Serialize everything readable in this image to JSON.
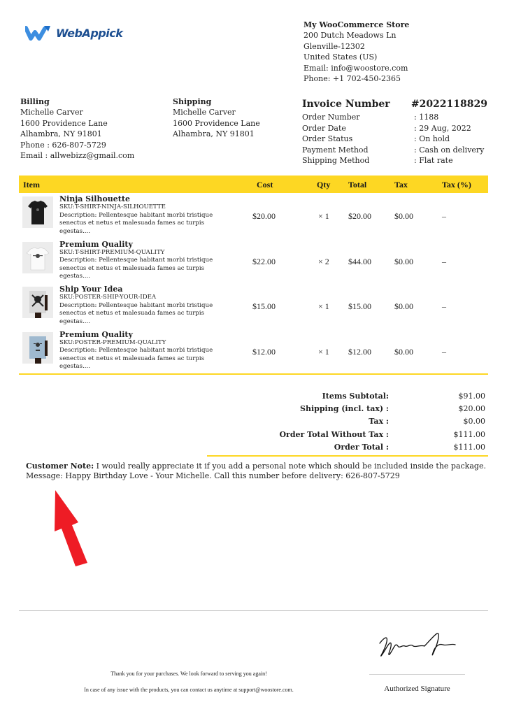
{
  "brand": {
    "logo_text": "WebAppick",
    "logo_color": "#1d4f91",
    "logo_mark_color": "#3d8ee0"
  },
  "store": {
    "name": "My WooCommerce Store",
    "lines": [
      "200 Dutch Meadows Ln",
      "Glenville-12302",
      "United States (US)",
      "Email: info@woostore.com",
      "Phone: +1 702-450-2365"
    ]
  },
  "billing": {
    "heading": "Billing",
    "lines": [
      "Michelle Carver",
      "1600 Providence Lane",
      "Alhambra, NY 91801",
      "Phone : 626-807-5729",
      "Email : allwebizz@gmail.com"
    ]
  },
  "shipping": {
    "heading": "Shipping",
    "lines": [
      "Michelle Carver",
      "1600 Providence Lane",
      "Alhambra, NY 91801"
    ]
  },
  "invoice": {
    "label": "Invoice Number",
    "number": "#2022118829",
    "fields": [
      {
        "label": "Order Number",
        "value": ": 1188"
      },
      {
        "label": "Order Date",
        "value": ": 29 Aug, 2022"
      },
      {
        "label": "Order Status",
        "value": ": On hold"
      },
      {
        "label": "Payment Method",
        "value": ": Cash on delivery"
      },
      {
        "label": "Shipping Method",
        "value": ": Flat rate"
      }
    ]
  },
  "table": {
    "accent_color": "#fdd723",
    "headers": {
      "item": "Item",
      "cost": "Cost",
      "qty": "Qty",
      "total": "Total",
      "tax": "Tax",
      "tax_pct": "Tax (%)"
    },
    "rows": [
      {
        "name": "Ninja Silhouette",
        "sku": "SKU:T-SHIRT-NINJA-SILHOUETTE",
        "description": "Description: Pellentesque habitant morbi tristique senectus et netus et malesuada fames ac turpis egestas....",
        "cost": "$20.00",
        "qty": "× 1",
        "total": "$20.00",
        "tax": "$0.00",
        "tax_pct": "–",
        "thumb": "black-tshirt"
      },
      {
        "name": "Premium Quality",
        "sku": "SKU:T-SHIRT-PREMIUM-QUALITY",
        "description": "Description: Pellentesque habitant morbi tristique senectus et netus et malesuada fames ac turpis egestas....",
        "cost": "$22.00",
        "qty": "× 2",
        "total": "$44.00",
        "tax": "$0.00",
        "tax_pct": "–",
        "thumb": "white-tshirt"
      },
      {
        "name": "Ship Your Idea",
        "sku": "SKU:POSTER-SHIP-YOUR-IDEA",
        "description": "Description: Pellentesque habitant morbi tristique senectus et netus et malesuada fames ac turpis egestas....",
        "cost": "$15.00",
        "qty": "× 1",
        "total": "$15.00",
        "tax": "$0.00",
        "tax_pct": "–",
        "thumb": "skull-poster"
      },
      {
        "name": "Premium Quality",
        "sku": "SKU:POSTER-PREMIUM-QUALITY",
        "description": "Description: Pellentesque habitant morbi tristique senectus et netus et malesuada fames ac turpis egestas....",
        "cost": "$12.00",
        "qty": "× 1",
        "total": "$12.00",
        "tax": "$0.00",
        "tax_pct": "–",
        "thumb": "blue-poster"
      }
    ]
  },
  "totals": [
    {
      "label": "Items Subtotal:",
      "value": "$91.00"
    },
    {
      "label": "Shipping (incl. tax) :",
      "value": "$20.00"
    },
    {
      "label": "Tax :",
      "value": "$0.00"
    },
    {
      "label": "Order Total Without Tax :",
      "value": "$111.00"
    },
    {
      "label": "Order Total :",
      "value": "$111.00"
    }
  ],
  "customer_note": {
    "label": "Customer Note:",
    "text": " I would really appreciate it if you add a personal note which should be included inside the package. Message: Happy Birthday Love - Your Michelle. Call this number before delivery: 626-807-5729"
  },
  "annotation": {
    "arrow_color": "#ee1c25"
  },
  "footer": {
    "thanks": "Thank you for your purchases. We look forward to serving you again!",
    "contact": "In case of any issue with the products, you can contact us anytime at support@woostore.com.",
    "signature_label": "Authorized Signature"
  }
}
